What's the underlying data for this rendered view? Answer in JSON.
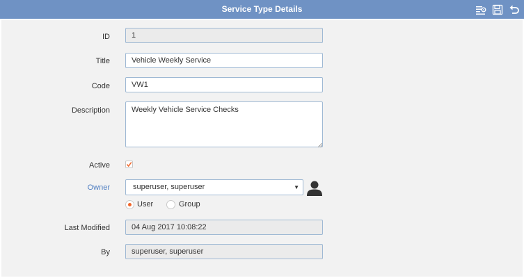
{
  "header": {
    "title": "Service Type Details",
    "icons": [
      "list-settings-icon",
      "save-icon",
      "undo-icon"
    ]
  },
  "form": {
    "id": {
      "label": "ID",
      "value": "1"
    },
    "title": {
      "label": "Title",
      "value": "Vehicle Weekly Service"
    },
    "code": {
      "label": "Code",
      "value": "VW1"
    },
    "description": {
      "label": "Description",
      "value": "Weekly Vehicle Service Checks"
    },
    "active": {
      "label": "Active",
      "checked": true
    },
    "owner": {
      "label": "Owner",
      "selected": "superuser, superuser",
      "radio_user": "User",
      "radio_group": "Group",
      "selected_radio": "User"
    },
    "last_modified": {
      "label": "Last Modified",
      "value": "04 Aug 2017 10:08:22"
    },
    "by": {
      "label": "By",
      "value": "superuser, superuser"
    }
  },
  "colors": {
    "header_bg": "#6f92c4",
    "accent": "#f0662a",
    "link": "#4f7ec2"
  }
}
